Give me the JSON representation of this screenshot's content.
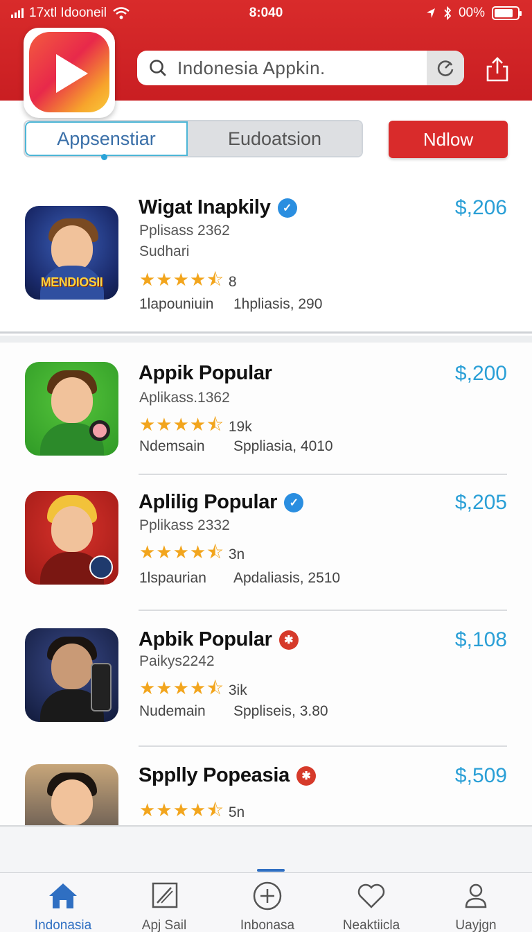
{
  "status_bar": {
    "carrier": "17xtl Idooneil",
    "time": "8:040",
    "battery": "00%",
    "battery_level": 0.8
  },
  "header": {
    "search_text": "Indonesia  Appkin."
  },
  "tabs": {
    "tab1": "Appsenstiar",
    "tab2": "Eudoatsion",
    "action": "Ndlow"
  },
  "apps": [
    {
      "title": "Wigat Inapkily",
      "badge": "verified",
      "line1": "Pplisass 2362",
      "line2": "Sudhari",
      "rating": 4.5,
      "rating_count": "8",
      "meta_left": "1lapouniuin",
      "meta_right": "1hpliasis, 290",
      "price": "$,206"
    },
    {
      "title": "Appik Popular",
      "badge": "",
      "line1": "Aplikass.1362",
      "line2": "",
      "rating": 4.5,
      "rating_count": "19k",
      "meta_left": "Ndemsain",
      "meta_right": "Sppliasia, 4010",
      "price": "$,200"
    },
    {
      "title": "Aplilig Popular",
      "badge": "verified",
      "line1": "Pplikass 2332",
      "line2": "",
      "rating": 4.5,
      "rating_count": "3n",
      "meta_left": "1lspaurian",
      "meta_right": "Apdaliasis, 2510",
      "price": "$,205"
    },
    {
      "title": "Apbik Popular",
      "badge": "star-red",
      "line1": "Paikys2242",
      "line2": "",
      "rating": 4.5,
      "rating_count": "3ik",
      "meta_left": "Nudemain",
      "meta_right": "Sppliseis, 3.80",
      "price": "$,108"
    },
    {
      "title": "Spplly Popeasia",
      "badge": "star-red",
      "line1": "",
      "line2": "",
      "rating": 4.5,
      "rating_count": "5n",
      "meta_left": "",
      "meta_right": "",
      "price": "$,509"
    }
  ],
  "stars_glyph": "★★★★⯪",
  "nav": [
    {
      "label": "Indonasia",
      "icon": "home-icon",
      "active": true
    },
    {
      "label": "Apj Sail",
      "icon": "apps-icon",
      "active": false
    },
    {
      "label": "Inbonasa",
      "icon": "plus-circle-icon",
      "active": false
    },
    {
      "label": "Neaktiicla",
      "icon": "heart-icon",
      "active": false
    },
    {
      "label": "Uayjgn",
      "icon": "profile-icon",
      "active": false
    }
  ],
  "colors": {
    "brand_red": "#d92b2b",
    "price_blue": "#2a9fd6",
    "star_gold": "#f2a51d",
    "nav_active": "#2f6fc2"
  }
}
